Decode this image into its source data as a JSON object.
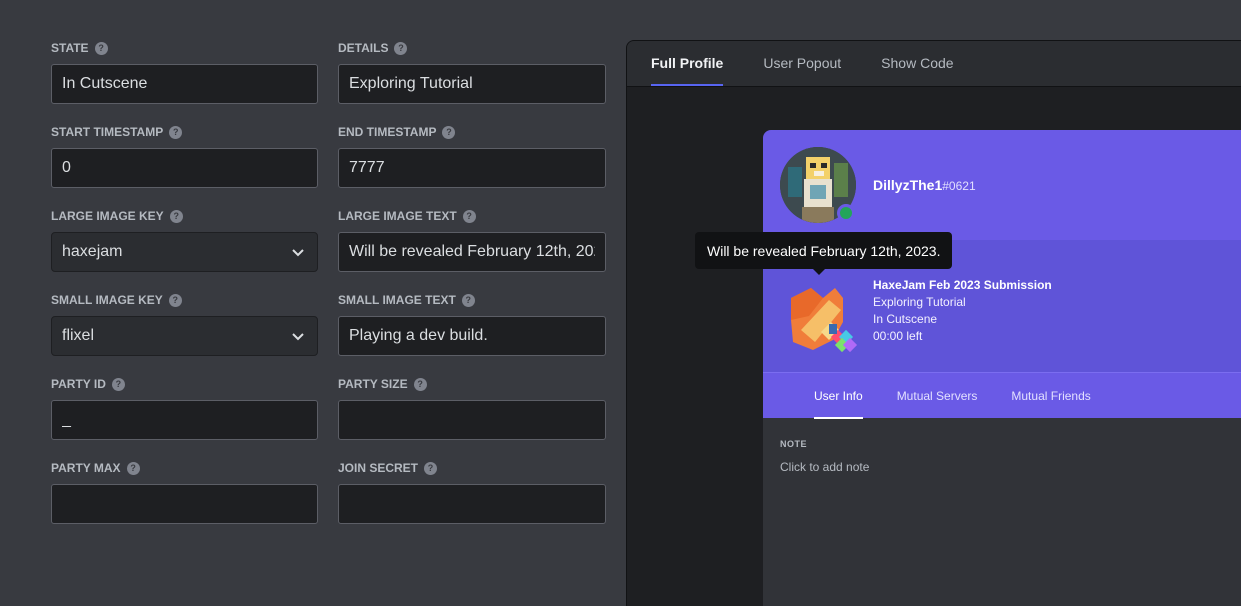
{
  "form": {
    "state": {
      "label": "STATE",
      "value": "In Cutscene"
    },
    "details": {
      "label": "DETAILS",
      "value": "Exploring Tutorial"
    },
    "start_timestamp": {
      "label": "START TIMESTAMP",
      "value": "0"
    },
    "end_timestamp": {
      "label": "END TIMESTAMP",
      "value": "7777"
    },
    "large_image_key": {
      "label": "LARGE IMAGE KEY",
      "value": "haxejam"
    },
    "large_image_text": {
      "label": "LARGE IMAGE TEXT",
      "value": "Will be revealed February 12th, 2023"
    },
    "small_image_key": {
      "label": "SMALL IMAGE KEY",
      "value": "flixel"
    },
    "small_image_text": {
      "label": "SMALL IMAGE TEXT",
      "value": "Playing a dev build."
    },
    "party_id": {
      "label": "PARTY ID",
      "value": "_"
    },
    "party_size": {
      "label": "PARTY SIZE",
      "value": ""
    },
    "party_max": {
      "label": "PARTY MAX",
      "value": ""
    },
    "join_secret": {
      "label": "JOIN SECRET",
      "value": ""
    },
    "help_glyph": "?"
  },
  "preview": {
    "tabs": [
      "Full Profile",
      "User Popout",
      "Show Code"
    ],
    "active_tab": "Full Profile",
    "user": {
      "name": "DillyzThe1",
      "discriminator": "#0621",
      "status": "online"
    },
    "tooltip": "Will be revealed February 12th, 2023.",
    "activity": {
      "name": "HaxeJam Feb 2023 Submission",
      "details": "Exploring Tutorial",
      "state": "In Cutscene",
      "time": "00:00 left"
    },
    "profile_tabs": [
      "User Info",
      "Mutual Servers",
      "Mutual Friends"
    ],
    "active_profile_tab": "User Info",
    "note_title": "NOTE",
    "note_placeholder": "Click to add note"
  },
  "colors": {
    "accent": "#5865f2",
    "banner": "#6a5ae6",
    "online": "#23a55a"
  }
}
